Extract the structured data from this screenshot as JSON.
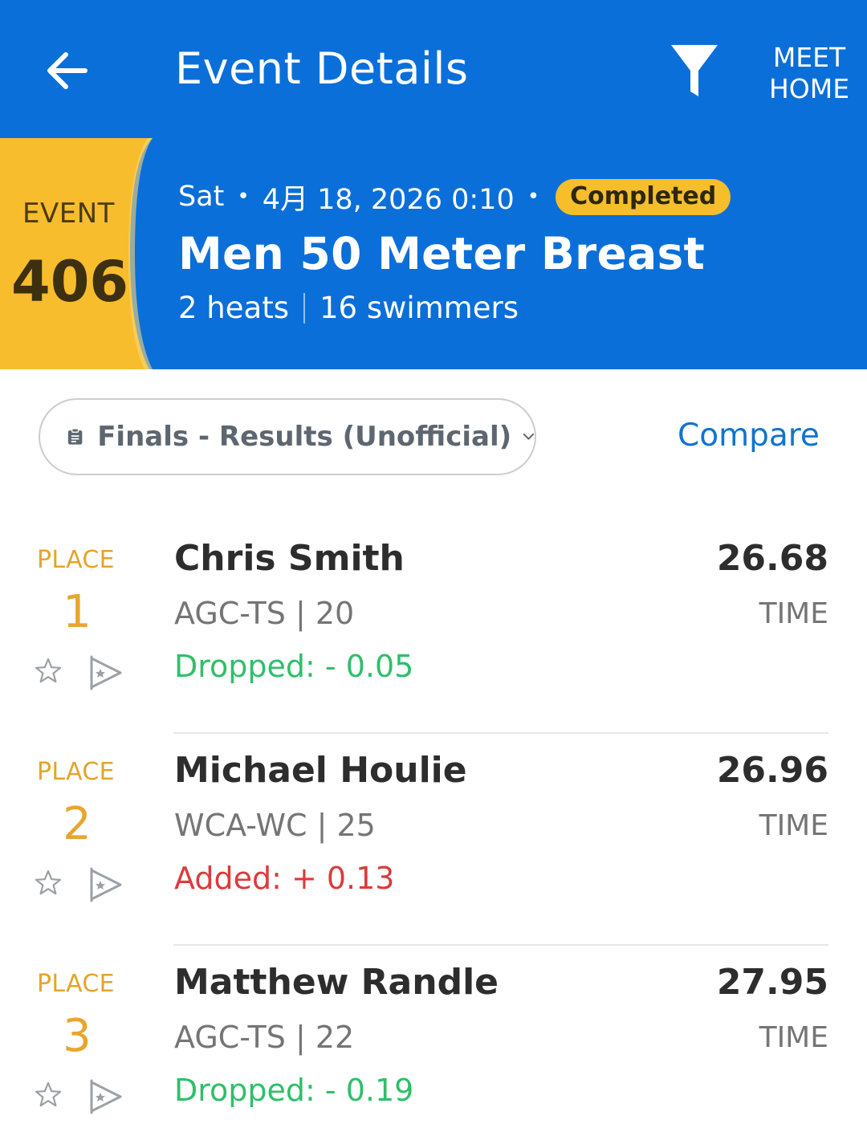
{
  "header": {
    "title": "Event Details",
    "meet_home_line1": "MEET",
    "meet_home_line2": "HOME"
  },
  "event": {
    "label": "EVENT",
    "number": "406",
    "day": "Sat",
    "datetime": "4月 18, 2026 0:10",
    "status": "Completed",
    "name": "Men 50 Meter Breast",
    "heats": "2 heats",
    "swimmers": "16 swimmers"
  },
  "toolbar": {
    "round_label": "Finals - Results (Unofficial)",
    "compare_label": "Compare"
  },
  "results": [
    {
      "place_label": "PLACE",
      "place": "1",
      "name": "Chris Smith",
      "team_age": "AGC-TS | 20",
      "delta": "Dropped: - 0.05",
      "delta_type": "dropped",
      "time": "26.68",
      "time_label": "TIME"
    },
    {
      "place_label": "PLACE",
      "place": "2",
      "name": "Michael Houlie",
      "team_age": "WCA-WC | 25",
      "delta": "Added: + 0.13",
      "delta_type": "added",
      "time": "26.96",
      "time_label": "TIME"
    },
    {
      "place_label": "PLACE",
      "place": "3",
      "name": "Matthew Randle",
      "team_age": "AGC-TS | 22",
      "delta": "Dropped: - 0.19",
      "delta_type": "dropped",
      "time": "27.95",
      "time_label": "TIME"
    }
  ],
  "colors": {
    "header_blue": "#0b6fd9",
    "badge_yellow": "#f8bd2c",
    "place_gold": "#e7a630",
    "dropped_green": "#2fbf6a",
    "added_red": "#dd3a3a",
    "link_blue": "#1173cf"
  }
}
